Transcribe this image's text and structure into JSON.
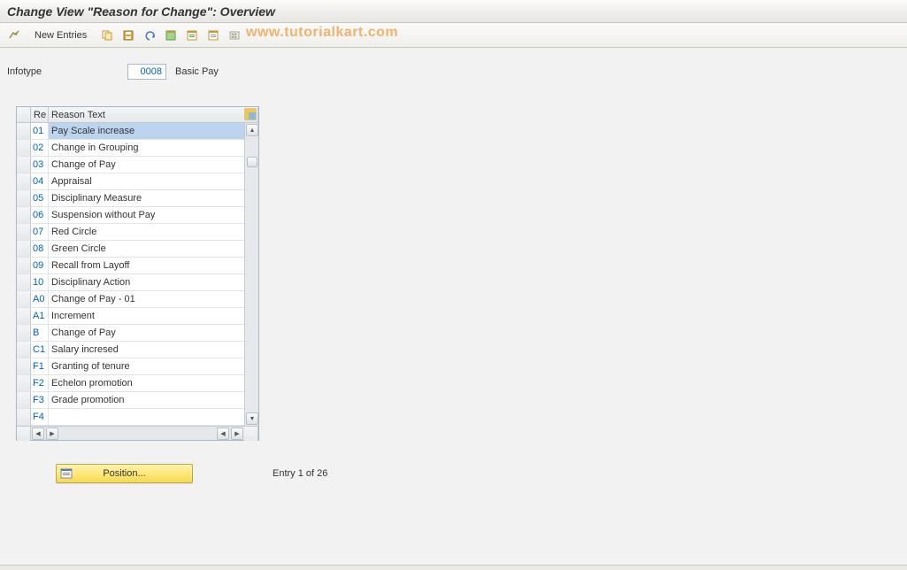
{
  "title": "Change View \"Reason for Change\": Overview",
  "toolbar": {
    "new_entries": "New Entries"
  },
  "watermark": "www.tutorialkart.com",
  "infotype": {
    "label": "Infotype",
    "value": "0008",
    "desc": "Basic Pay"
  },
  "grid": {
    "col_code": "Re",
    "col_text": "Reason Text",
    "rows": [
      {
        "code": "01",
        "text": "Pay Scale increase",
        "selected": true
      },
      {
        "code": "02",
        "text": "Change in Grouping"
      },
      {
        "code": "03",
        "text": "Change of Pay"
      },
      {
        "code": "04",
        "text": "Appraisal"
      },
      {
        "code": "05",
        "text": "Disciplinary Measure"
      },
      {
        "code": "06",
        "text": "Suspension without Pay"
      },
      {
        "code": "07",
        "text": "Red Circle"
      },
      {
        "code": "08",
        "text": "Green Circle"
      },
      {
        "code": "09",
        "text": "Recall from Layoff"
      },
      {
        "code": "10",
        "text": "Disciplinary Action"
      },
      {
        "code": "A0",
        "text": "Change of Pay - 01"
      },
      {
        "code": "A1",
        "text": "Increment"
      },
      {
        "code": "B",
        "text": "Change of Pay"
      },
      {
        "code": "C1",
        "text": "Salary incresed"
      },
      {
        "code": "F1",
        "text": "Granting of tenure"
      },
      {
        "code": "F2",
        "text": "Echelon promotion"
      },
      {
        "code": "F3",
        "text": "Grade promotion"
      },
      {
        "code": "F4",
        "text": ""
      }
    ]
  },
  "footer": {
    "position_label": "Position...",
    "entry_text": "Entry 1 of 26"
  }
}
